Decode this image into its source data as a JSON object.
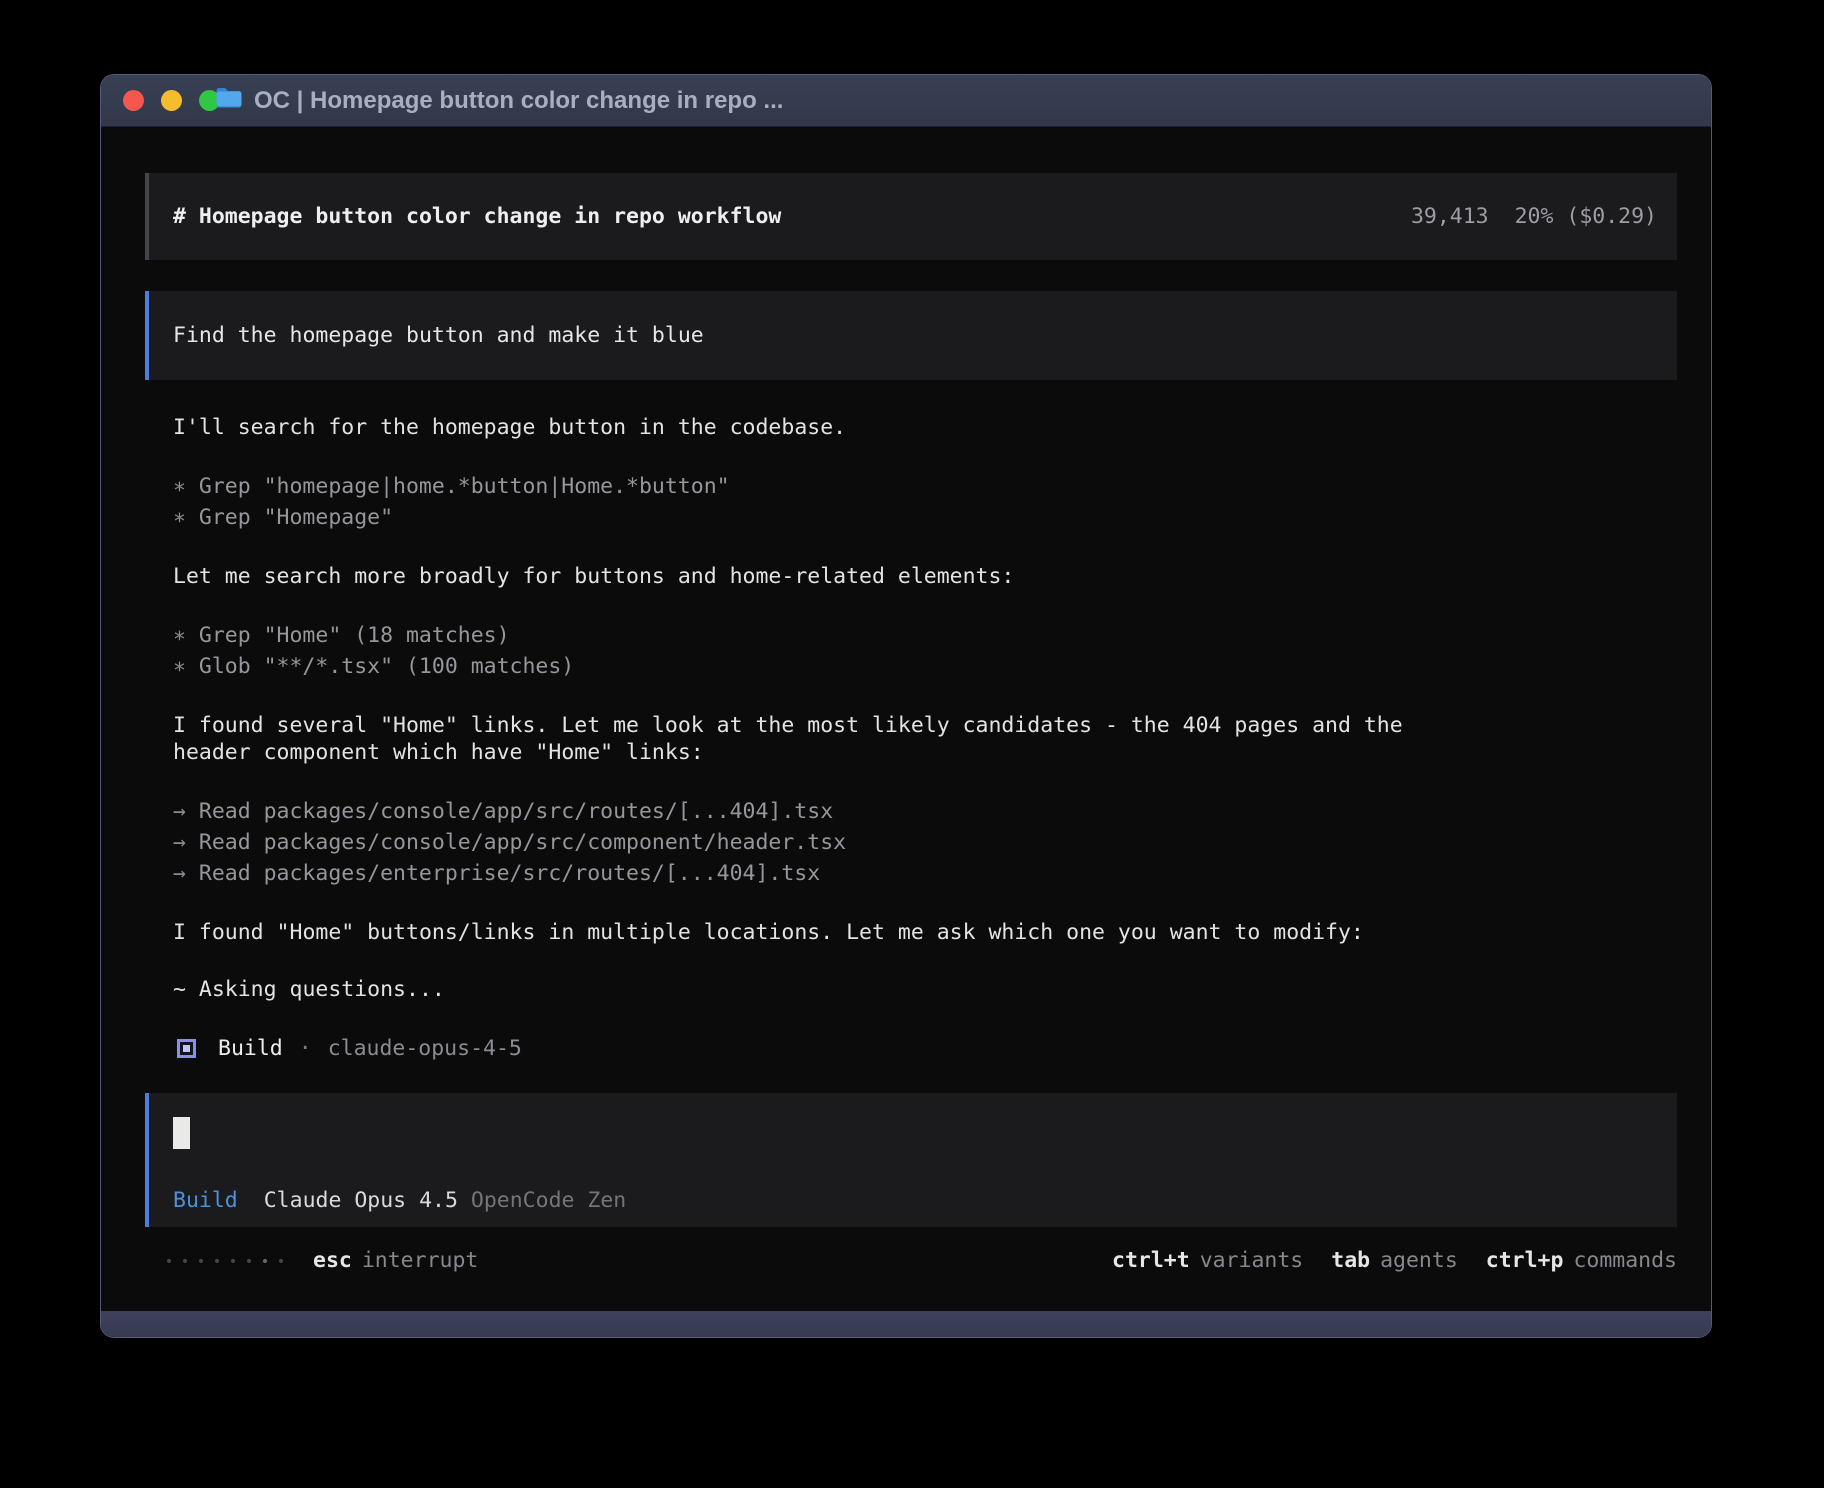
{
  "window": {
    "title": "OC | Homepage button color change in repo ..."
  },
  "session_header": {
    "title": "# Homepage button color change in repo workflow",
    "tokens": "39,413",
    "context": "20% ($0.29)"
  },
  "user_message": {
    "text": "Find the homepage button and make it blue"
  },
  "assistant": {
    "para1": "I'll search for the homepage button in the codebase.",
    "tools1": [
      {
        "icon": "∗",
        "label": "Grep \"homepage|home.*button|Home.*button\""
      },
      {
        "icon": "∗",
        "label": "Grep \"Homepage\""
      }
    ],
    "para2": "Let me search more broadly for buttons and home-related elements:",
    "tools2": [
      {
        "icon": "∗",
        "label": "Grep \"Home\" (18 matches)"
      },
      {
        "icon": "∗",
        "label": "Glob \"**/*.tsx\" (100 matches)"
      }
    ],
    "para3": "I found several \"Home\" links. Let me look at the most likely candidates - the 404 pages and the header component which have \"Home\" links:",
    "tools3": [
      {
        "icon": "→",
        "label": "Read packages/console/app/src/routes/[...404].tsx"
      },
      {
        "icon": "→",
        "label": "Read packages/console/app/src/component/header.tsx"
      },
      {
        "icon": "→",
        "label": "Read packages/enterprise/src/routes/[...404].tsx"
      }
    ],
    "para4": "I found \"Home\" buttons/links in multiple locations. Let me ask which one you want to modify:",
    "working_status": "~ Asking questions...",
    "agent": {
      "name": "Build",
      "separator": "·",
      "model": "claude-opus-4-5"
    }
  },
  "prompt": {
    "mode": "Build",
    "model": "Claude Opus 4.5",
    "provider": "OpenCode Zen"
  },
  "statusbar": {
    "esc_key": "esc",
    "esc_label": "interrupt",
    "shortcuts": [
      {
        "key": "ctrl+t",
        "label": "variants"
      },
      {
        "key": "tab",
        "label": "agents"
      },
      {
        "key": "ctrl+p",
        "label": "commands"
      }
    ]
  },
  "colors": {
    "accent_blue": "#4d7ce2",
    "mode_blue": "#4e90d9",
    "agent_icon_lavender": "#8a90e6",
    "traffic_red": "#f5564d",
    "traffic_yellow": "#f5bd2e",
    "traffic_green": "#30c744"
  }
}
